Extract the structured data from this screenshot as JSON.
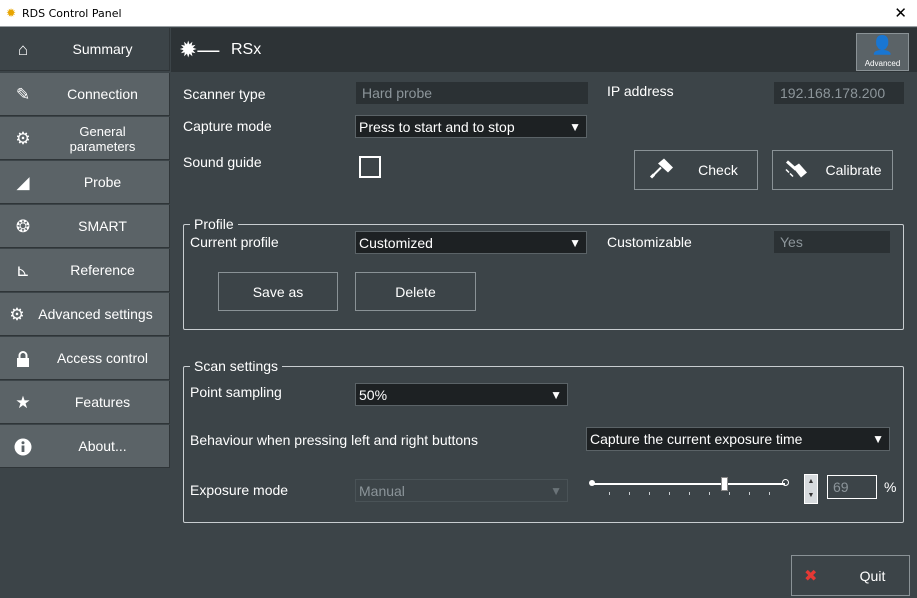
{
  "window": {
    "title": "RDS Control Panel",
    "close_glyph": "✕"
  },
  "sidebar": {
    "items": [
      {
        "label": "Summary",
        "icon": "home-icon",
        "glyph": "⌂"
      },
      {
        "label": "Connection",
        "icon": "connection-icon",
        "glyph": "✎"
      },
      {
        "label": "General parameters",
        "icon": "gear-icon",
        "glyph": "⚙"
      },
      {
        "label": "Probe",
        "icon": "probe-icon",
        "glyph": "◢"
      },
      {
        "label": "SMART",
        "icon": "smart-icon",
        "glyph": "❂"
      },
      {
        "label": "Reference",
        "icon": "axes-icon",
        "glyph": "⊾"
      },
      {
        "label": "Advanced settings",
        "icon": "advanced-gear-icon",
        "glyph": "⚙"
      },
      {
        "label": "Access control",
        "icon": "lock-icon",
        "glyph": "🔒"
      },
      {
        "label": "Features",
        "icon": "star-icon",
        "glyph": "★"
      },
      {
        "label": "About...",
        "icon": "info-icon",
        "glyph": "ℹ"
      }
    ]
  },
  "header": {
    "device": "RSx",
    "device_glyph": "✹—",
    "advanced_label": "Advanced",
    "advanced_glyph": "👤"
  },
  "device": {
    "scanner_type_label": "Scanner type",
    "scanner_type_value": "Hard probe",
    "ip_label": "IP address",
    "ip_value": "192.168.178.200",
    "capture_mode_label": "Capture mode",
    "capture_mode_value": "Press to start and to stop",
    "sound_guide_label": "Sound guide",
    "check_label": "Check",
    "calibrate_label": "Calibrate"
  },
  "profile": {
    "group_title": "Profile",
    "current_label": "Current profile",
    "current_value": "Customized",
    "customizable_label": "Customizable",
    "customizable_value": "Yes",
    "save_as_label": "Save as",
    "delete_label": "Delete"
  },
  "scan": {
    "group_title": "Scan settings",
    "point_sampling_label": "Point sampling",
    "point_sampling_value": "50%",
    "behaviour_label": "Behaviour when pressing left and right buttons",
    "behaviour_value": "Capture the current exposure time",
    "exposure_label": "Exposure mode",
    "exposure_value": "Manual",
    "exposure_level_percent": 69,
    "exposure_number": "69",
    "percent_sign": "%"
  },
  "footer": {
    "quit_label": "Quit",
    "quit_glyph": "✖"
  },
  "colors": {
    "background": "#3c4448",
    "sidebar_item": "#5b6367",
    "header": "#2d3336",
    "quit_icon": "#e53935"
  },
  "dropdown_arrow": "▼"
}
